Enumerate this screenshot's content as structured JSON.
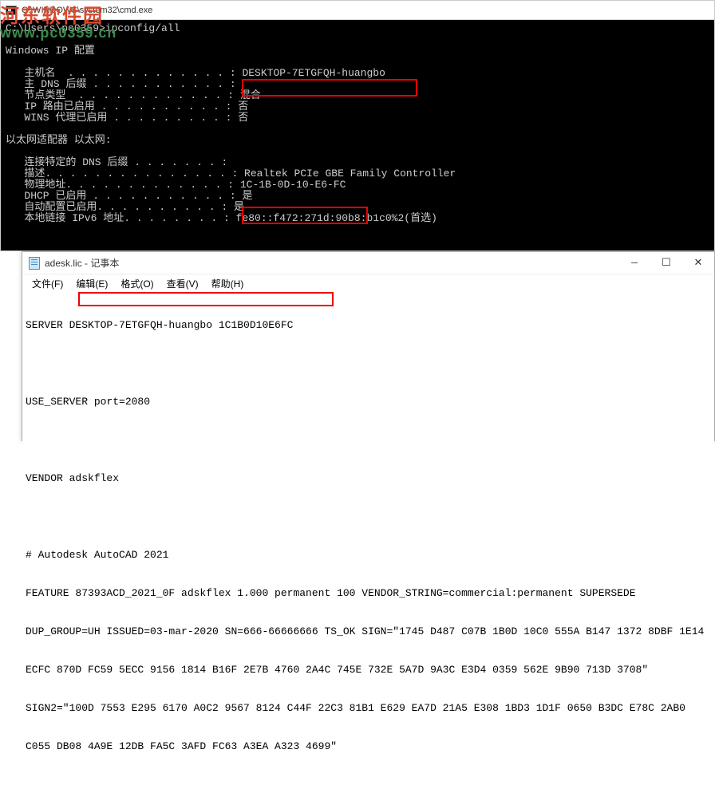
{
  "watermark": {
    "line1": "河东软件园",
    "line2": "www.pc0359.cn"
  },
  "cmd": {
    "title": "C:\\WINDOWS\\system32\\cmd.exe",
    "prompt": "C:\\Users\\pc0359>ipconfig/all",
    "header": "Windows IP 配置",
    "lines": {
      "host_label": "   主机名  . . . . . . . . . . . . . : ",
      "host_value": "DESKTOP-7ETGFQH-huangbo",
      "dns_suffix": "   主 DNS 后缀 . . . . . . . . . . . : ",
      "node_type": "   节点类型  . . . . . . . . . . . . : 混合",
      "ip_route": "   IP 路由已启用 . . . . . . . . . . : 否",
      "wins_proxy": "   WINS 代理已启用 . . . . . . . . . : 否",
      "adapter_header": "以太网适配器 以太网:",
      "conn_dns": "   连接特定的 DNS 后缀 . . . . . . . : ",
      "desc": "   描述. . . . . . . . . . . . . . . : Realtek PCIe GBE Family Controller",
      "phys_label": "   物理地址. . . . . . . . . . . . . : ",
      "phys_value": "1C-1B-0D-10-E6-FC",
      "dhcp": "   DHCP 已启用 . . . . . . . . . . . : 是",
      "autoconf": "   自动配置已启用. . . . . . . . . . : 是",
      "ipv6_local": "   本地链接 IPv6 地址. . . . . . . . : fe80::f472:271d:90b8:b1c0%2(首选)"
    }
  },
  "notepad": {
    "title": "adesk.lic - 记事本",
    "menu": {
      "file": "文件(F)",
      "edit": "编辑(E)",
      "format": "格式(O)",
      "view": "查看(V)",
      "help": "帮助(H)"
    },
    "content": {
      "l1": "SERVER DESKTOP-7ETGFQH-huangbo 1C1B0D10E6FC",
      "l2": "",
      "l3": "USE_SERVER port=2080",
      "l4": "",
      "l5": "VENDOR adskflex",
      "l6": "",
      "l7": "# Autodesk AutoCAD 2021",
      "l8": "FEATURE 87393ACD_2021_0F adskflex 1.000 permanent 100 VENDOR_STRING=commercial:permanent SUPERSEDE",
      "l9": "DUP_GROUP=UH ISSUED=03-mar-2020 SN=666-66666666 TS_OK SIGN=\"1745 D487 C07B 1B0D 10C0 555A B147 1372 8DBF 1E14",
      "l10": "ECFC 870D FC59 5ECC 9156 1814 B16F 2E7B 4760 2A4C 745E 732E 5A7D 9A3C E3D4 0359 562E 9B90 713D 3708\"",
      "l11": "SIGN2=\"100D 7553 E295 6170 A0C2 9567 8124 C44F 22C3 81B1 E629 EA7D 21A5 E308 1BD3 1D1F 0650 B3DC E78C 2AB0",
      "l12": "C055 DB08 4A9E 12DB FA5C 3AFD FC63 A3EA A323 4699\""
    },
    "controls": {
      "min": "—",
      "max": "☐",
      "close": "✕"
    }
  }
}
